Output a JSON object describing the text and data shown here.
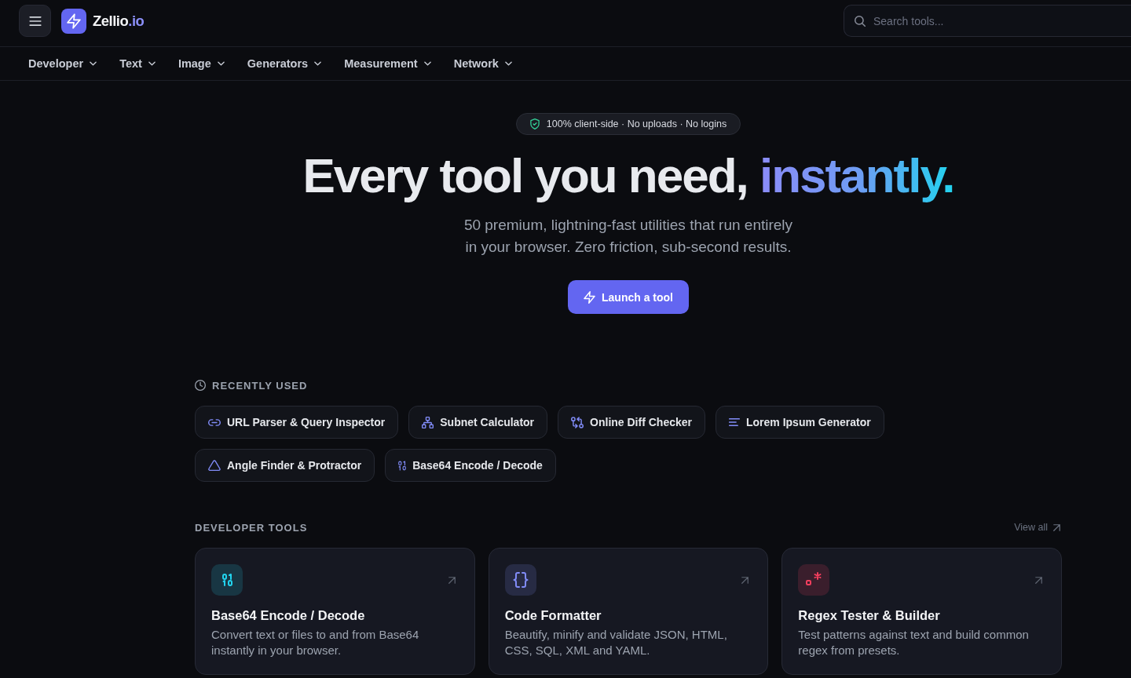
{
  "header": {
    "brand": {
      "name": "Zellio",
      "suffix": ".io"
    },
    "search": {
      "placeholder": "Search tools..."
    }
  },
  "nav": [
    "Developer",
    "Text",
    "Image",
    "Generators",
    "Measurement",
    "Network"
  ],
  "hero": {
    "badge": "100% client-side · No uploads · No logins",
    "title": "Every tool you need,",
    "title_accent": "instantly.",
    "subtitle": "50 premium, lightning-fast utilities that run entirely in your browser. Zero friction, sub-second results.",
    "cta": "Launch a tool"
  },
  "recently_used": {
    "heading": "RECENTLY USED",
    "tools": [
      "URL Parser & Query Inspector",
      "Subnet Calculator",
      "Online Diff Checker",
      "Lorem Ipsum Generator",
      "Angle Finder & Protractor",
      "Base64 Encode / Decode"
    ]
  },
  "developer_tools": {
    "heading": "DEVELOPER TOOLS",
    "view_all": "View all",
    "cards": [
      {
        "title": "Base64 Encode / Decode",
        "description": "Convert text or files to and from Base64 instantly in your browser.",
        "color": "#22d3ee"
      },
      {
        "title": "Code Formatter",
        "description": "Beautify, minify and validate JSON, HTML, CSS, SQL, XML and YAML.",
        "color": "#818cf8"
      },
      {
        "title": "Regex Tester & Builder",
        "description": "Test patterns against text and build common regex from presets.",
        "color": "#f43f5e"
      }
    ]
  }
}
